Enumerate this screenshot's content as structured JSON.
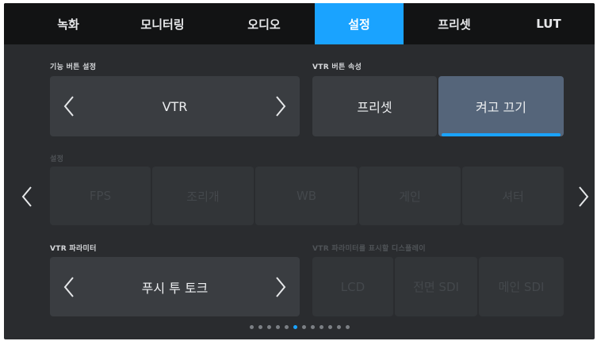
{
  "tabs": [
    {
      "label": "녹화"
    },
    {
      "label": "모니터링"
    },
    {
      "label": "오디오"
    },
    {
      "label": "설정",
      "active": true
    },
    {
      "label": "프리셋"
    },
    {
      "label": "LUT"
    }
  ],
  "function_button": {
    "label": "기능 버튼 설정",
    "value": "VTR"
  },
  "vtr_button_mode": {
    "label": "VTR 버튼 속성",
    "options": [
      "프리셋",
      "켜고 끄기"
    ],
    "selected": "켜고 끄기"
  },
  "settings": {
    "label": "설정",
    "options": [
      "FPS",
      "조리개",
      "WB",
      "게인",
      "셔터"
    ]
  },
  "vtr_parameter": {
    "label": "VTR 파라미터",
    "value": "푸시 투 토크"
  },
  "vtr_display": {
    "label": "VTR 파라미터를 표시할 디스플레이",
    "options": [
      "LCD",
      "전면 SDI",
      "메인 SDI"
    ]
  },
  "pagination": {
    "total": 12,
    "current": 5
  },
  "colors": {
    "accent": "#1aa3ff",
    "background": "#2a2c2f",
    "tabbar": "#121314"
  }
}
